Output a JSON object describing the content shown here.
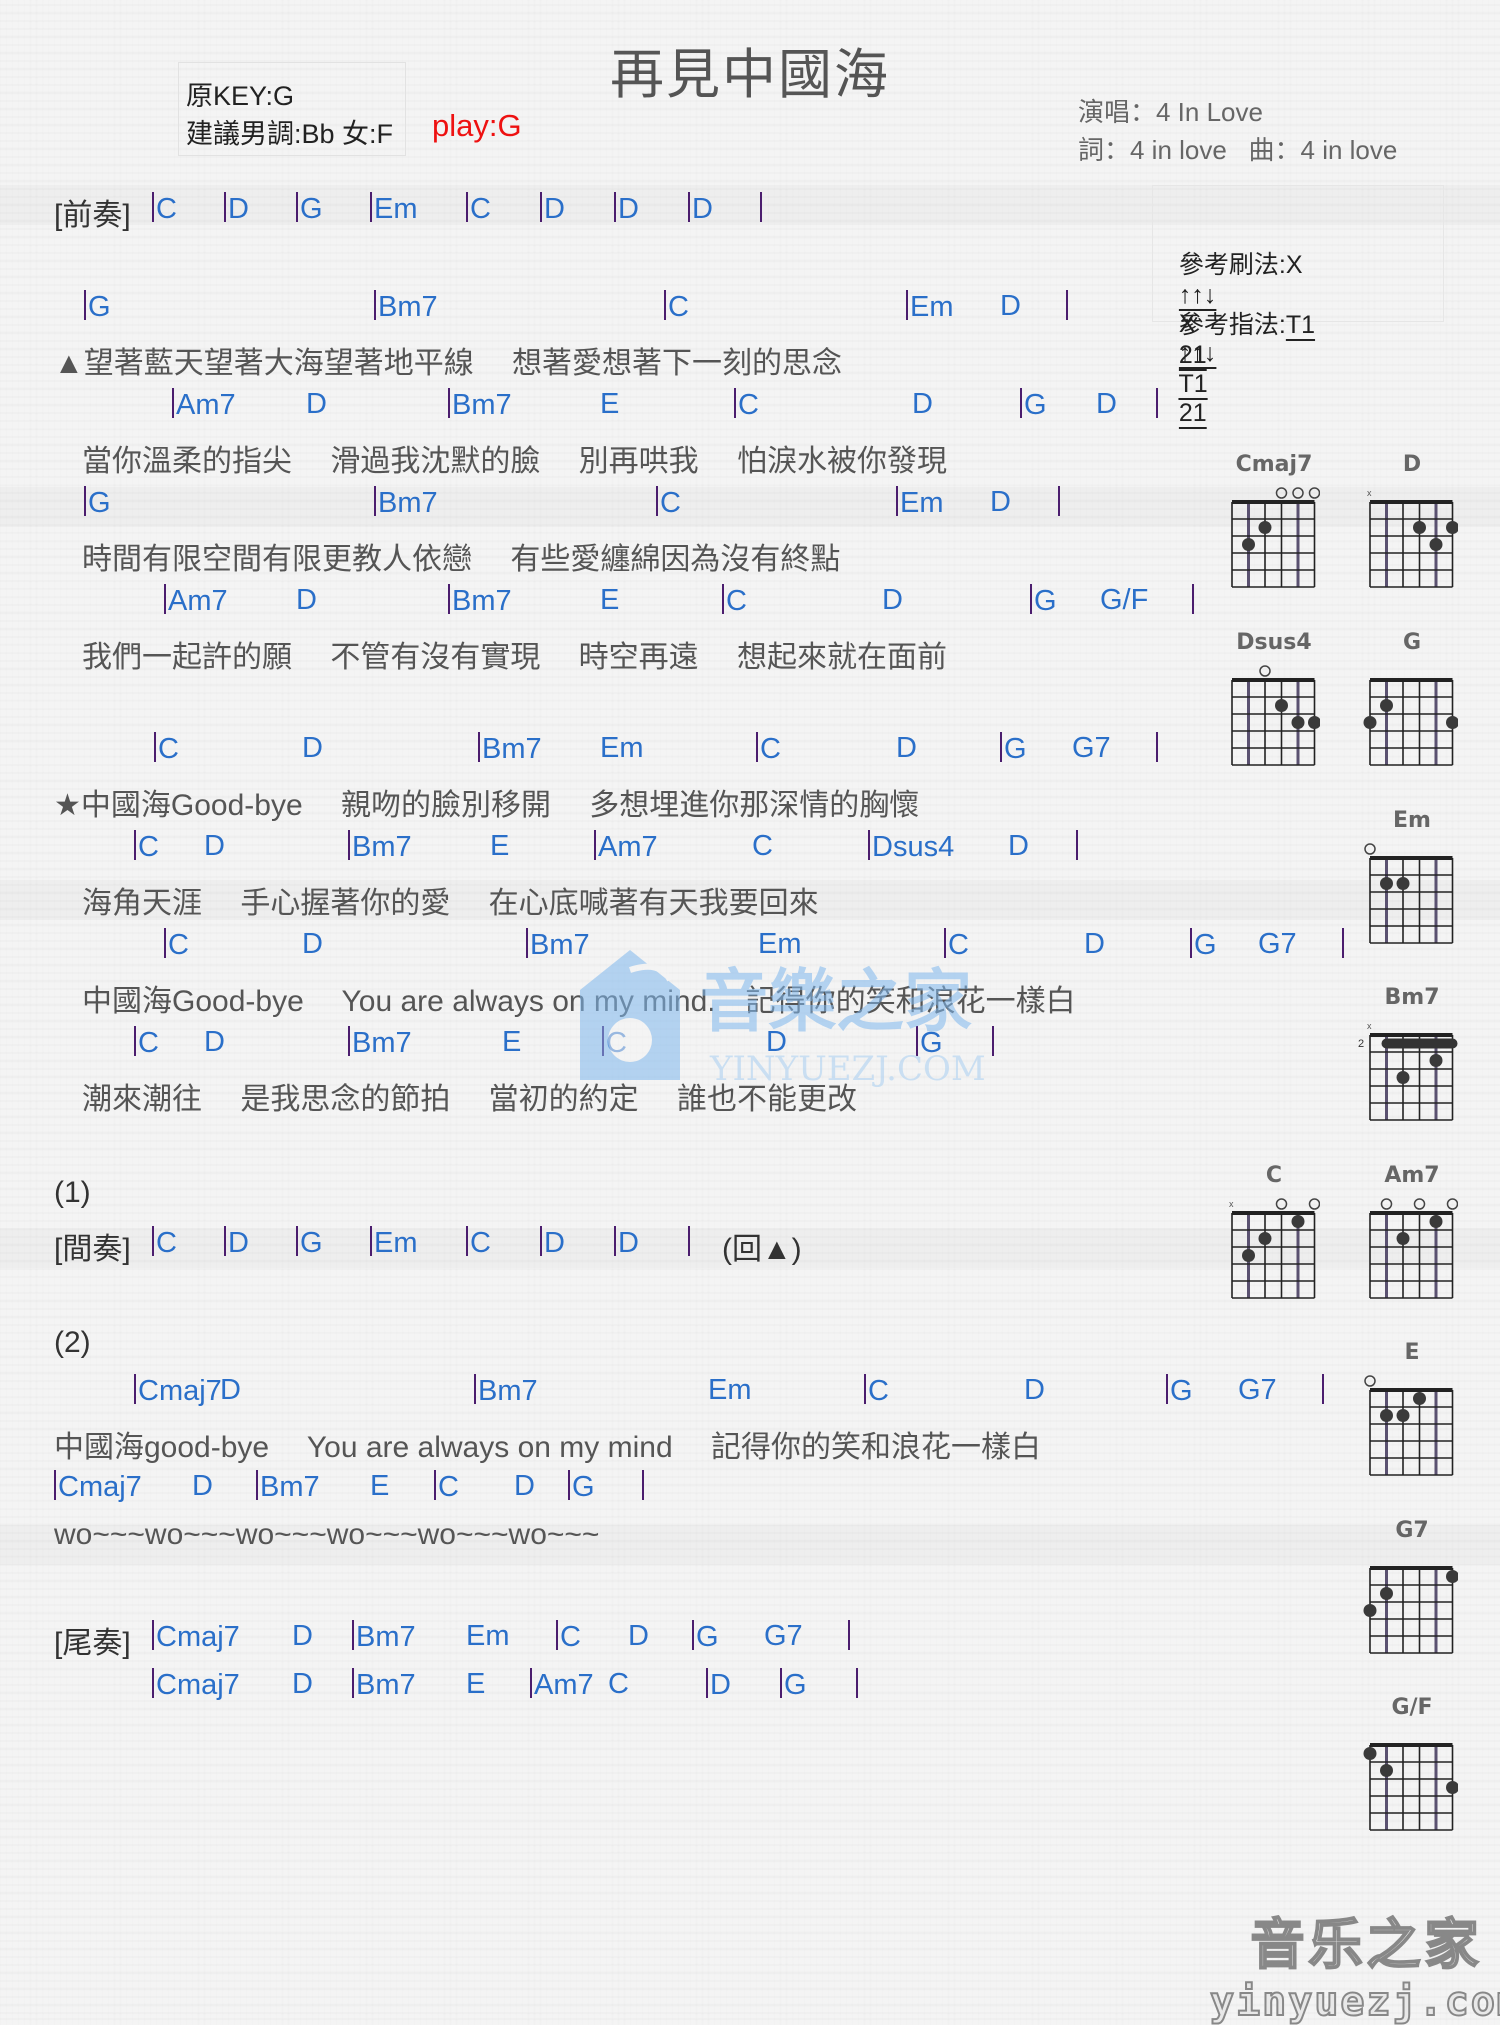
{
  "title": "再見中國海",
  "key_info": {
    "original_key": "原KEY:G",
    "suggested": "建議男調:Bb 女:F",
    "play": "play:G"
  },
  "credits": {
    "singer": "演唱：4 In Love",
    "lyrics_music": "詞：4 in love   曲：4 in love"
  },
  "reference": {
    "strum_label": "參考刷法:",
    "strum_pattern": [
      "X",
      "↑↑↓",
      "X",
      "↑↑↓"
    ],
    "finger_label": "參考指法:",
    "finger_pattern": [
      "T1",
      "21",
      "T1",
      "21"
    ]
  },
  "colors": {
    "chord": "#2a6fc9",
    "bar": "#4b1d6e",
    "lyric": "#555555",
    "play": "#ee1111"
  },
  "sheet": [
    {
      "type": "chords",
      "prefix": "[前奏]",
      "chords": [
        "C",
        "D",
        "G",
        "Em",
        "C",
        "D",
        "D",
        "D",
        ""
      ],
      "bars": [
        true,
        true,
        true,
        true,
        true,
        true,
        true,
        true,
        true
      ]
    },
    {
      "type": "chords",
      "chords": [
        "G",
        "Bm7",
        "C",
        "Em",
        "D",
        ""
      ],
      "bars": [
        true,
        true,
        true,
        true,
        false,
        true
      ]
    },
    {
      "type": "lyric",
      "text": "▲望著藍天望著大海望著地平線　 想著愛想著下一刻的思念"
    },
    {
      "type": "chords",
      "chords": [
        "Am7",
        "D",
        "Bm7",
        "E",
        "C",
        "D",
        "G",
        "D",
        ""
      ],
      "bars": [
        true,
        false,
        true,
        false,
        true,
        false,
        true,
        false,
        true
      ]
    },
    {
      "type": "lyric",
      "text": "當你溫柔的指尖　 滑過我沈默的臉　 別再哄我　 怕淚水被你發現"
    },
    {
      "type": "chords",
      "chords": [
        "G",
        "Bm7",
        "C",
        "Em",
        "D",
        ""
      ],
      "bars": [
        true,
        true,
        true,
        true,
        false,
        true
      ]
    },
    {
      "type": "lyric",
      "text": "時間有限空間有限更教人依戀　 有些愛纏綿因為沒有終點"
    },
    {
      "type": "chords",
      "chords": [
        "Am7",
        "D",
        "Bm7",
        "E",
        "C",
        "D",
        "G",
        "G/F",
        ""
      ],
      "bars": [
        true,
        false,
        true,
        false,
        true,
        false,
        true,
        false,
        true
      ]
    },
    {
      "type": "lyric",
      "text": "我們一起許的願　 不管有沒有實現　 時空再遠　 想起來就在面前"
    },
    {
      "type": "chords",
      "chords": [
        "C",
        "D",
        "Bm7",
        "Em",
        "C",
        "D",
        "G",
        "G7",
        ""
      ],
      "bars": [
        true,
        false,
        true,
        false,
        true,
        false,
        true,
        false,
        true
      ]
    },
    {
      "type": "lyric",
      "text": "★中國海Good-bye　 親吻的臉別移開　 多想埋進你那深情的胸懷"
    },
    {
      "type": "chords",
      "chords": [
        "C",
        "D",
        "Bm7",
        "E",
        "Am7",
        "C",
        "Dsus4",
        "D",
        ""
      ],
      "bars": [
        true,
        false,
        true,
        false,
        true,
        false,
        true,
        false,
        true
      ]
    },
    {
      "type": "lyric",
      "text": "海角天涯　 手心握著你的愛　 在心底喊著有天我要回來"
    },
    {
      "type": "chords",
      "chords": [
        "C",
        "D",
        "Bm7",
        "Em",
        "C",
        "D",
        "G",
        "G7",
        ""
      ],
      "bars": [
        true,
        false,
        true,
        false,
        true,
        false,
        true,
        false,
        true
      ]
    },
    {
      "type": "lyric",
      "text": "中國海Good-bye　 You are always on my mind.　記得你的笑和浪花一樣白"
    },
    {
      "type": "chords",
      "chords": [
        "C",
        "D",
        "Bm7",
        "E",
        "C",
        "D",
        "G",
        ""
      ],
      "bars": [
        true,
        false,
        true,
        false,
        true,
        false,
        true,
        true
      ]
    },
    {
      "type": "lyric",
      "text": "潮來潮往　 是我思念的節拍　 當初的約定　 誰也不能更改"
    },
    {
      "type": "label",
      "text": "(1)"
    },
    {
      "type": "chords",
      "prefix": "[間奏]",
      "chords": [
        "C",
        "D",
        "G",
        "Em",
        "C",
        "D",
        "D",
        ""
      ],
      "bars": [
        true,
        true,
        true,
        true,
        true,
        true,
        true,
        true
      ],
      "suffix": "(回▲)"
    },
    {
      "type": "label",
      "text": "(2)"
    },
    {
      "type": "chords",
      "chords": [
        "Cmaj7",
        "D",
        "Bm7",
        "Em",
        "C",
        "D",
        "G",
        "G7",
        ""
      ],
      "bars": [
        true,
        false,
        true,
        false,
        true,
        false,
        true,
        false,
        true
      ]
    },
    {
      "type": "lyric",
      "text": "中國海good-bye　 You are always on my mind　 記得你的笑和浪花一樣白"
    },
    {
      "type": "chords",
      "chords": [
        "Cmaj7",
        "D",
        "Bm7",
        "E",
        "C",
        "D",
        "G",
        ""
      ],
      "bars": [
        true,
        false,
        true,
        false,
        true,
        false,
        true,
        true
      ]
    },
    {
      "type": "lyric",
      "text": "wo~~~wo~~~wo~~~wo~~~wo~~~wo~~~"
    },
    {
      "type": "chords",
      "prefix": "[尾奏]",
      "chords": [
        "Cmaj7",
        "D",
        "Bm7",
        "Em",
        "C",
        "D",
        "G",
        "G7",
        ""
      ],
      "bars": [
        true,
        false,
        true,
        false,
        true,
        false,
        true,
        false,
        true
      ]
    },
    {
      "type": "chords",
      "chords": [
        "Cmaj7",
        "D",
        "Bm7",
        "E",
        "Am7",
        "C",
        "D",
        "G",
        ""
      ],
      "bars": [
        true,
        false,
        true,
        false,
        true,
        false,
        true,
        true,
        true
      ]
    }
  ],
  "chord_diagrams": [
    {
      "name": "Cmaj7",
      "strings": [
        "x",
        "3",
        "2",
        "0",
        "0",
        "0"
      ],
      "open_markers": [
        "",
        "",
        "",
        "o",
        "o",
        "o"
      ],
      "base_fret": "",
      "barre": null
    },
    {
      "name": "D",
      "strings": [
        "x",
        "x",
        "0",
        "2",
        "3",
        "2"
      ],
      "open_markers": [
        "x",
        "",
        "",
        "",
        "",
        ""
      ],
      "base_fret": "",
      "barre": null
    },
    {
      "name": "Dsus4",
      "strings": [
        "x",
        "x",
        "0",
        "2",
        "3",
        "3"
      ],
      "open_markers": [
        "",
        "",
        "o",
        "",
        "",
        ""
      ],
      "base_fret": "",
      "barre": null
    },
    {
      "name": "G",
      "strings": [
        "3",
        "2",
        "0",
        "0",
        "0",
        "3"
      ],
      "open_markers": [
        "",
        "",
        "",
        "",
        "",
        ""
      ],
      "base_fret": "",
      "barre": null
    },
    {
      "name": "Em",
      "strings": [
        "0",
        "2",
        "2",
        "0",
        "0",
        "0"
      ],
      "open_markers": [
        "o",
        "",
        "",
        "",
        "",
        ""
      ],
      "base_fret": "",
      "barre": null
    },
    {
      "name": "Bm7",
      "strings": [
        "x",
        "2",
        "4",
        "2",
        "3",
        "2"
      ],
      "open_markers": [
        "x",
        "",
        "",
        "",
        "",
        ""
      ],
      "base_fret": "2",
      "barre": "1"
    },
    {
      "name": "C",
      "strings": [
        "x",
        "3",
        "2",
        "0",
        "1",
        "0"
      ],
      "open_markers": [
        "x",
        "",
        "",
        "o",
        "",
        "o"
      ],
      "base_fret": "",
      "barre": null
    },
    {
      "name": "Am7",
      "strings": [
        "x",
        "0",
        "2",
        "0",
        "1",
        "0"
      ],
      "open_markers": [
        "",
        "o",
        "",
        "o",
        "",
        "o"
      ],
      "base_fret": "",
      "barre": null
    },
    {
      "name": "E",
      "strings": [
        "0",
        "2",
        "2",
        "1",
        "0",
        "0"
      ],
      "open_markers": [
        "o",
        "",
        "",
        "",
        "",
        ""
      ],
      "base_fret": "",
      "barre": null
    },
    {
      "name": "G7",
      "strings": [
        "3",
        "2",
        "0",
        "0",
        "0",
        "1"
      ],
      "open_markers": [
        "",
        "",
        "",
        "",
        "",
        ""
      ],
      "base_fret": "",
      "barre": null
    },
    {
      "name": "G/F",
      "strings": [
        "1",
        "2",
        "0",
        "0",
        "0",
        "3"
      ],
      "open_markers": [
        "",
        "",
        "",
        "",
        "",
        ""
      ],
      "base_fret": "",
      "barre": null
    }
  ],
  "watermark": {
    "cn": "音樂之家",
    "en": "YINYUEZJ.COM"
  },
  "logo": {
    "cn": "音乐之家",
    "en": "yinyuezj.com"
  }
}
